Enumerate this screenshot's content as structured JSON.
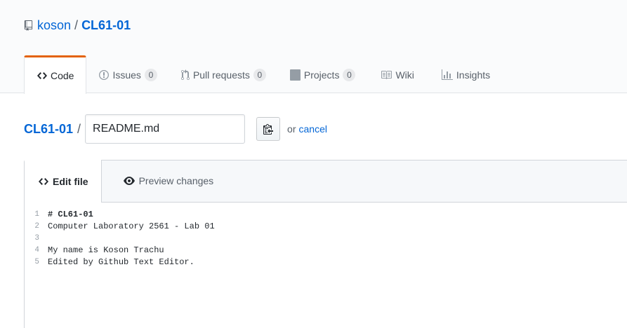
{
  "repo": {
    "owner": "koson",
    "separator": "/",
    "name": "CL61-01"
  },
  "nav": {
    "code": {
      "label": "Code"
    },
    "issues": {
      "label": "Issues",
      "count": "0"
    },
    "pulls": {
      "label": "Pull requests",
      "count": "0"
    },
    "projects": {
      "label": "Projects",
      "count": "0"
    },
    "wiki": {
      "label": "Wiki"
    },
    "insights": {
      "label": "Insights"
    }
  },
  "breadcrumb": {
    "root": "CL61-01",
    "slash": "/",
    "filename_value": "README.md",
    "or_text": "or",
    "cancel": "cancel"
  },
  "editor": {
    "tabs": {
      "edit": "Edit file",
      "preview": "Preview changes"
    },
    "lines": [
      {
        "num": "1",
        "text": "# CL61-01"
      },
      {
        "num": "2",
        "text": "Computer Laboratory 2561 - Lab 01"
      },
      {
        "num": "3",
        "text": ""
      },
      {
        "num": "4",
        "text": "My name is Koson Trachu"
      },
      {
        "num": "5",
        "text": "Edited by Github Text Editor."
      }
    ]
  },
  "colors": {
    "link": "#0366d6",
    "accent": "#e36209",
    "muted": "#586069"
  },
  "icons": [
    "repo-icon",
    "code-icon",
    "issue-icon",
    "pull-request-icon",
    "project-icon",
    "book-icon",
    "graph-icon",
    "clippy-icon",
    "eye-icon"
  ]
}
